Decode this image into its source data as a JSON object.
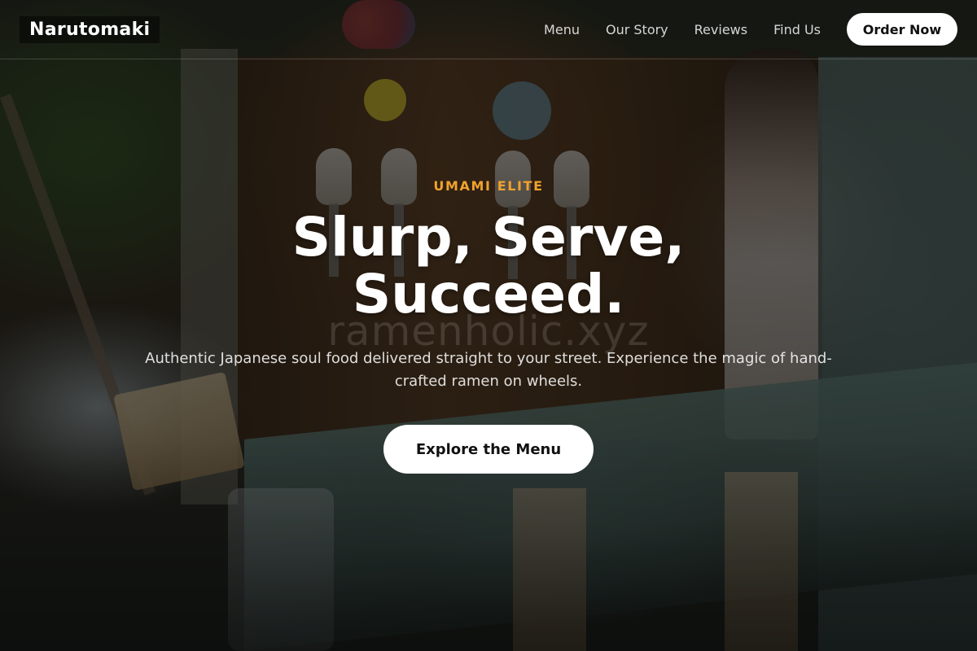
{
  "brand": {
    "name": "Narutomaki"
  },
  "nav": {
    "links": [
      {
        "label": "Menu"
      },
      {
        "label": "Our Story"
      },
      {
        "label": "Reviews"
      },
      {
        "label": "Find Us"
      }
    ],
    "cta_label": "Order Now"
  },
  "hero": {
    "eyebrow": "UMAMI ELITE",
    "headline": "Slurp, Serve, Succeed.",
    "watermark": "ramenholic.xyz",
    "tagline": "Authentic Japanese soul food delivered straight to your street. Experience the magic of hand-crafted ramen on wheels.",
    "cta_label": "Explore the Menu"
  },
  "colors": {
    "accent": "#f0a22e",
    "button_bg": "#ffffff",
    "button_text": "#111111"
  }
}
